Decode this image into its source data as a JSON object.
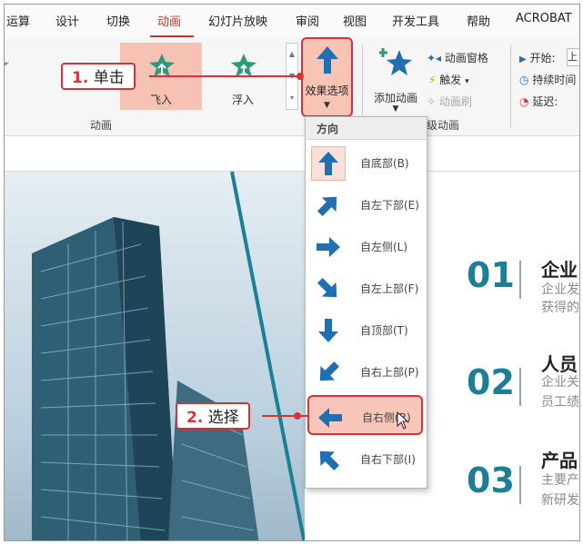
{
  "tabs": [
    "运算",
    "设计",
    "切换",
    "动画",
    "幻灯片放映",
    "审阅",
    "视图",
    "开发工具",
    "帮助",
    "ACROBAT"
  ],
  "active_tab": "动画",
  "ribbon": {
    "gallery": [
      {
        "label": "现",
        "icon": "star-appear-icon"
      },
      {
        "label": "飞入",
        "icon": "star-fly-in-icon"
      },
      {
        "label": "浮入",
        "icon": "star-float-in-icon"
      }
    ],
    "effect_options_label": "效果选项",
    "add_animation_label": "添加动画",
    "animation_pane_label": "动画窗格",
    "trigger_label": "触发",
    "animation_painter_label": "动画刷",
    "group_animation_label": "动画",
    "group_advanced_label": "级动画",
    "start_label": "开始:",
    "start_value": "上",
    "duration_label": "持续时间",
    "delay_label": "延迟:"
  },
  "dropdown": {
    "header": "方向",
    "items": [
      {
        "label": "自底部(B)",
        "icon": "arrow-up-icon"
      },
      {
        "label": "自左下部(E)",
        "icon": "arrow-up-right-icon"
      },
      {
        "label": "自左侧(L)",
        "icon": "arrow-right-icon"
      },
      {
        "label": "自左上部(F)",
        "icon": "arrow-down-right-icon"
      },
      {
        "label": "自顶部(T)",
        "icon": "arrow-down-icon"
      },
      {
        "label": "自右上部(P)",
        "icon": "arrow-down-left-icon"
      },
      {
        "label": "自右侧(R)",
        "icon": "arrow-left-icon"
      },
      {
        "label": "自右下部(I)",
        "icon": "arrow-up-left-icon"
      }
    ],
    "selected": "自右侧(R)"
  },
  "callouts": {
    "step1_num": "1.",
    "step1_text": "单击",
    "step2_num": "2.",
    "step2_text": "选择"
  },
  "slide": {
    "rows": [
      {
        "num": "01",
        "title": "企业",
        "line1": "企业发",
        "line2": "获得的"
      },
      {
        "num": "02",
        "title": "人员",
        "line1": "企业关",
        "line2": "员工绩"
      },
      {
        "num": "03",
        "title": "产品",
        "line1": "主要产",
        "line2": "新研发"
      }
    ]
  },
  "colors": {
    "accent_red": "#d9313a",
    "teal": "#1b7f96",
    "star_green": "#2e9a78",
    "arrow_blue": "#1f6fb2"
  }
}
